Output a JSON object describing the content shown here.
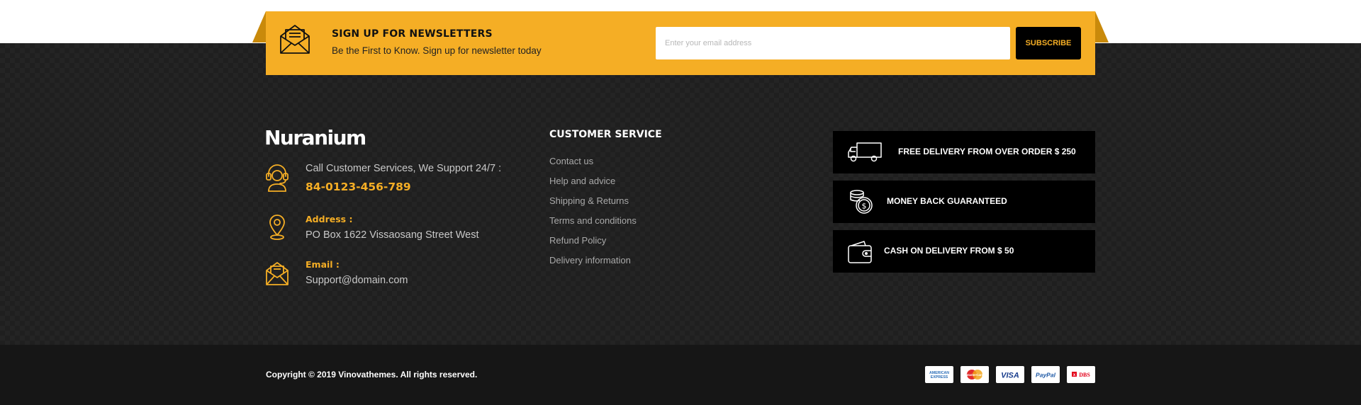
{
  "newsletter": {
    "title": "SIGN UP FOR NEWSLETTERS",
    "subtitle": "Be the First to Know. Sign up for newsletter today",
    "email_placeholder": "Enter your email address",
    "email_value": "",
    "subscribe_label": "SUBSCRIBE",
    "icon": "envelope-letter-icon"
  },
  "brand": {
    "logo_text": "Nuranium"
  },
  "contact": {
    "support": {
      "label": "Call Customer Services, We Support 24/7 :",
      "phone": "84-0123-456-789",
      "icon": "headset-icon"
    },
    "address": {
      "label": "Address :",
      "value": "PO Box 1622 Vissaosang Street West",
      "icon": "map-pin-icon"
    },
    "email": {
      "label": "Email :",
      "value": "Support@domain.com",
      "icon": "email-icon"
    }
  },
  "customer_service": {
    "title": "CUSTOMER SERVICE",
    "links": [
      "Contact us",
      "Help and advice",
      "Shipping & Returns",
      "Terms and conditions",
      "Refund Policy",
      "Delivery information"
    ]
  },
  "features": [
    {
      "text": "FREE DELIVERY FROM OVER ORDER $ 250",
      "icon": "truck-icon"
    },
    {
      "text": "MONEY BACK GUARANTEED",
      "icon": "coins-icon"
    },
    {
      "text": "CASH ON DELIVERY FROM $ 50",
      "icon": "wallet-icon"
    }
  ],
  "footer": {
    "copyright": "Copyright © 2019 Vinovathemes. All rights reserved.",
    "payments": [
      {
        "name": "american-express",
        "label": "AMERICAN EXPRESS"
      },
      {
        "name": "mastercard",
        "label": "MasterCard"
      },
      {
        "name": "visa",
        "label": "VISA"
      },
      {
        "name": "paypal",
        "label": "PayPal"
      },
      {
        "name": "dbs",
        "label": "DBS"
      }
    ]
  },
  "colors": {
    "accent": "#f5ae25",
    "dark_bg": "#1f1f1f",
    "bottom_bg": "#161616",
    "feature_bg": "#000000"
  }
}
